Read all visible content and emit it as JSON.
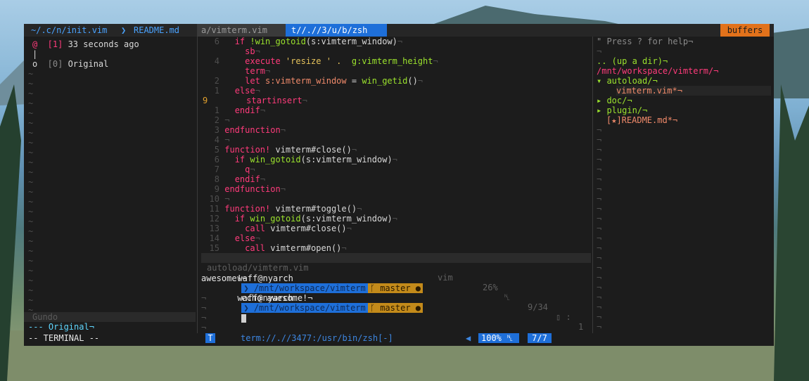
{
  "tabs": [
    "~/.c/n/init.vim",
    "README.md",
    "a/vimterm.vim",
    "t//.//3/u/b/zsh"
  ],
  "buffers_label": "buffers",
  "gundo": {
    "entries": [
      {
        "mark": "@",
        "num": "[1]",
        "text": "33 seconds ago"
      },
      {
        "mark": "|",
        "num": "",
        "text": ""
      },
      {
        "mark": "o",
        "num": "[0]",
        "text": "Original"
      }
    ],
    "status": "Gundo",
    "preview": "--- Original¬"
  },
  "code": {
    "lines": [
      {
        "n": "6",
        "i": "  ",
        "parts": [
          [
            "kw",
            "if "
          ],
          [
            "fn",
            "!win_gotoid"
          ],
          [
            "",
            "(s:vimterm_window)"
          ]
        ]
      },
      {
        "n": "",
        "i": "    ",
        "parts": [
          [
            "kw",
            "sb"
          ]
        ]
      },
      {
        "n": "4",
        "i": "    ",
        "parts": [
          [
            "kw",
            "execute "
          ],
          [
            "str",
            "'resize ' .  "
          ],
          [
            "fn",
            "g:vimterm_height"
          ]
        ]
      },
      {
        "n": "",
        "i": "    ",
        "parts": [
          [
            "kw",
            "term"
          ]
        ]
      },
      {
        "n": "2",
        "i": "    ",
        "parts": [
          [
            "kw",
            "let "
          ],
          [
            "vr",
            "s:vimterm_window"
          ],
          [
            "",
            " = "
          ],
          [
            "fn",
            "win_getid"
          ],
          [
            "",
            "()"
          ]
        ]
      },
      {
        "n": "1",
        "i": "  ",
        "parts": [
          [
            "kw",
            "else"
          ]
        ]
      },
      {
        "n": "9",
        "i": "    ",
        "parts": [
          [
            "kw",
            "startinsert"
          ]
        ]
      },
      {
        "n": "1",
        "i": "  ",
        "parts": [
          [
            "kw",
            "endif"
          ]
        ]
      },
      {
        "n": "2",
        "i": "",
        "parts": []
      },
      {
        "n": "3",
        "i": "",
        "parts": [
          [
            "kw",
            "endfunction"
          ]
        ]
      },
      {
        "n": "4",
        "i": "",
        "parts": []
      },
      {
        "n": "5",
        "i": "",
        "parts": [
          [
            "kw",
            "function! "
          ],
          [
            "",
            "vimterm#close"
          ],
          [
            "",
            "()"
          ]
        ]
      },
      {
        "n": "6",
        "i": "  ",
        "parts": [
          [
            "kw",
            "if "
          ],
          [
            "fn",
            "win_gotoid"
          ],
          [
            "",
            "(s:vimterm_window)"
          ]
        ]
      },
      {
        "n": "7",
        "i": "    ",
        "parts": [
          [
            "kw",
            "q"
          ]
        ]
      },
      {
        "n": "8",
        "i": "  ",
        "parts": [
          [
            "kw",
            "endif"
          ]
        ]
      },
      {
        "n": "9",
        "i": "",
        "parts": [
          [
            "kw",
            "endfunction"
          ]
        ]
      },
      {
        "n": "10",
        "i": "",
        "parts": []
      },
      {
        "n": "11",
        "i": "",
        "parts": [
          [
            "kw",
            "function! "
          ],
          [
            "",
            "vimterm#toggle"
          ],
          [
            "",
            "()"
          ]
        ]
      },
      {
        "n": "12",
        "i": "  ",
        "parts": [
          [
            "kw",
            "if "
          ],
          [
            "fn",
            "win_gotoid"
          ],
          [
            "",
            "(s:vimterm_window)"
          ]
        ]
      },
      {
        "n": "13",
        "i": "    ",
        "parts": [
          [
            "kw",
            "call "
          ],
          [
            "",
            "vimterm#close"
          ],
          [
            "",
            "()"
          ]
        ]
      },
      {
        "n": "14",
        "i": "  ",
        "parts": [
          [
            "kw",
            "else"
          ]
        ]
      },
      {
        "n": "15",
        "i": "    ",
        "parts": [
          [
            "kw",
            "call "
          ],
          [
            "",
            "vimterm#open"
          ],
          [
            "",
            "()"
          ]
        ]
      }
    ],
    "status": {
      "file": "autoload/vimterm.vim",
      "ft": "vim",
      "pct": "26%",
      "pos": "9/34",
      "col": "1"
    }
  },
  "terminal": {
    "user": "waff@nyarch",
    "path": "/mnt/workspace/vimterm",
    "branch": "master ●",
    "cmd": "echo awesome!¬",
    "output": "awesome!¬"
  },
  "tree": {
    "help": "\" Press ? for help¬",
    "up": ".. (up a dir)¬",
    "root": "/mnt/workspace/vimterm/¬",
    "items": [
      {
        "marker": "▾ ",
        "name": "autoload/¬",
        "color": "#9be22d",
        "indent": 0
      },
      {
        "marker": "",
        "name": "vimterm.vim*¬",
        "color": "#f08a6a",
        "indent": 2
      },
      {
        "marker": "▸ ",
        "name": "doc/¬",
        "color": "#9be22d",
        "indent": 0
      },
      {
        "marker": "▸ ",
        "name": "plugin/¬",
        "color": "#9be22d",
        "indent": 0
      },
      {
        "marker": "",
        "name": "[★]README.md*¬",
        "color": "#f08a6a",
        "indent": 1
      }
    ]
  },
  "bottom": {
    "mode": "-- TERMINAL --",
    "flag": "T",
    "bufname": "term://.//3477:/usr/bin/zsh[-]",
    "pct": "100%",
    "lines": "7/7"
  }
}
